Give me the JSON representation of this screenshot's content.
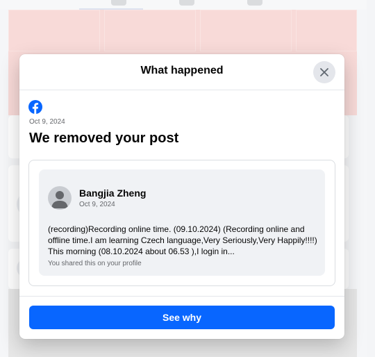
{
  "dialog": {
    "title": "What happened",
    "close_icon": "close-icon"
  },
  "notice": {
    "brand_icon": "facebook-icon",
    "date": "Oct 9, 2024",
    "headline": "We removed your post"
  },
  "post": {
    "author": "Bangjia Zheng",
    "date": "Oct 9, 2024",
    "text": "(recording)Recording online time. (09.10.2024)   (Recording online and offline time.I am learning Czech language,Very Seriously,Very Happily!!!!) This morning (08.10.2024 about 06.53 ),I login in...",
    "shared_note": "You shared this on your profile"
  },
  "actions": {
    "see_why_label": "See why"
  },
  "colors": {
    "brand": "#0866ff",
    "close_bg": "#e4e6eb",
    "post_bg": "#f0f2f5",
    "cover": "#f4c7c4"
  }
}
